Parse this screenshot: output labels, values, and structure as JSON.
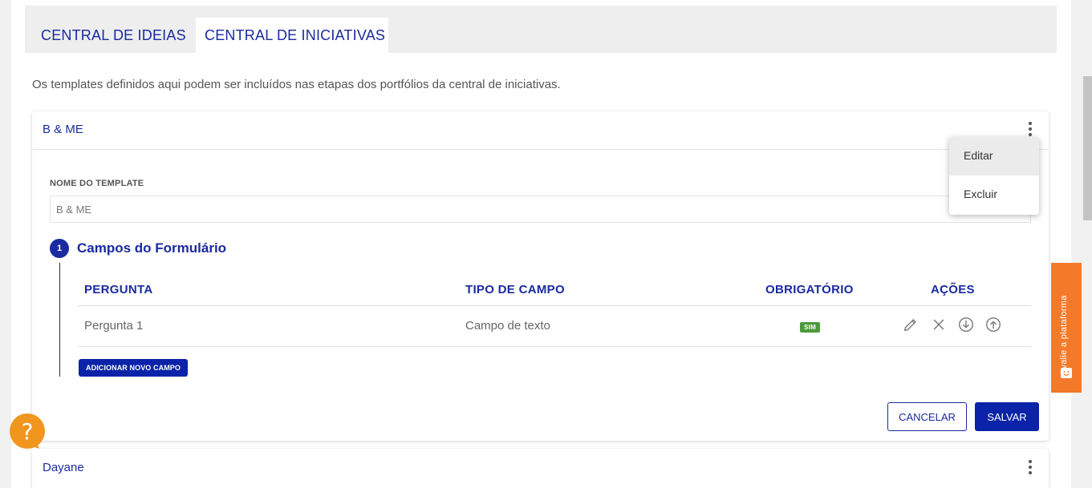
{
  "tabs": [
    {
      "label": "CENTRAL DE IDEIAS"
    },
    {
      "label": "CENTRAL DE INICIATIVAS"
    }
  ],
  "intro_text": "Os templates definidos aqui podem ser incluídos nas etapas dos portfólios da central de iniciativas.",
  "template_card": {
    "title": "B & ME",
    "field_label": "NOME DO TEMPLATE",
    "field_value": "B & ME",
    "step_number": "1",
    "step_title": "Campos do Formulário",
    "table": {
      "headers": {
        "pergunta": "PERGUNTA",
        "tipo": "TIPO DE CAMPO",
        "obrigatorio": "OBRIGATÓRIO",
        "acoes": "AÇÕES"
      },
      "rows": [
        {
          "pergunta": "Pergunta 1",
          "tipo": "Campo de texto",
          "obrigatorio": "SIM"
        }
      ]
    },
    "add_field_label": "ADICIONAR NOVO CAMPO",
    "cancel_label": "CANCELAR",
    "save_label": "SALVAR"
  },
  "context_menu": {
    "items": [
      {
        "label": "Editar"
      },
      {
        "label": "Excluir"
      }
    ]
  },
  "second_card": {
    "title": "Dayane"
  },
  "feedback_tab": {
    "label": "Avalie a plataforma"
  },
  "colors": {
    "primary": "#1a2aa0",
    "button": "#0a23a8",
    "success_badge": "#4a9a3a",
    "feedback": "#f47a2a",
    "help": "#f0961e"
  }
}
